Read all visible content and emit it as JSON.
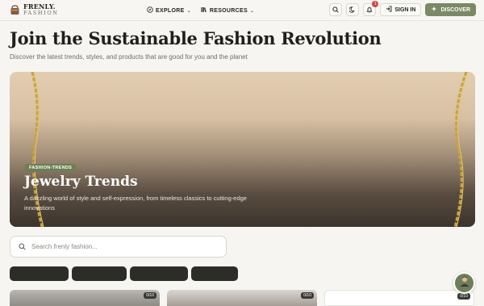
{
  "brand": {
    "name": "FRENLY.",
    "sub": "FASHION"
  },
  "nav": {
    "explore_label": "EXPLORE",
    "resources_label": "RESOURCES",
    "notifications_count": "1",
    "signin_label": "SIGN IN",
    "discover_label": "DISCOVER"
  },
  "page": {
    "title": "Join the Sustainable Fashion Revolution",
    "subtitle": "Discover the latest trends, styles, and products that are good for you and the planet"
  },
  "hero": {
    "tag": "FASHION-TRENDS",
    "title": "Jewelry Trends",
    "description": "A dazzling world of style and self-expression, from timeless classics to cutting-edge innovations"
  },
  "search": {
    "placeholder": "Search frenly fashion..."
  },
  "cards": [
    {
      "count": "0/10"
    },
    {
      "count": "0/10"
    },
    {
      "count": "0/10"
    }
  ],
  "colors": {
    "accent": "#7a8a63",
    "tag": "#6d7e55",
    "chip": "#2c2d27",
    "badge": "#d64545"
  }
}
